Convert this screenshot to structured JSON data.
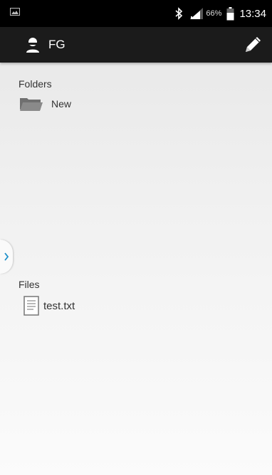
{
  "status_bar": {
    "battery_percent": "66%",
    "time": "13:34",
    "icons": [
      "image-notification-icon",
      "bluetooth-icon",
      "signal-icon",
      "battery-icon"
    ]
  },
  "action_bar": {
    "title": "FG",
    "icons": [
      "user-icon",
      "pencil-edit-icon"
    ]
  },
  "folders": {
    "label": "Folders",
    "items": [
      {
        "name": "New",
        "icon": "folder-icon"
      }
    ]
  },
  "files": {
    "label": "Files",
    "items": [
      {
        "name": "test.txt",
        "icon": "text-file-icon"
      }
    ]
  },
  "drawer_handle": {
    "icon": "chevron-right-icon"
  },
  "colors": {
    "status_bar_bg": "#000000",
    "action_bar_bg": "#1b1b1b",
    "accent_blue": "#1c8fc9",
    "text": "#333333"
  }
}
